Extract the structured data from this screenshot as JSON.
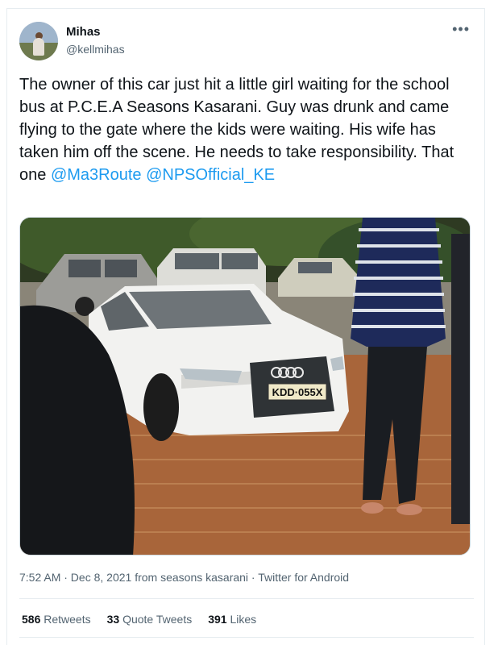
{
  "author": {
    "display_name": "Mihas",
    "handle": "@kellmihas"
  },
  "tweet": {
    "text_before": "The owner of this car just hit a little girl waiting for the school bus at P.C.E.A Seasons Kasarani. Guy was drunk and came flying to the gate where the kids were waiting. His wife has taken him off the scene. He needs to take responsibility. That one ",
    "mention_1": "@Ma3Route",
    "mention_2": "@NPSOfficial_KE"
  },
  "photo": {
    "plate_text": "KDD·055X"
  },
  "meta": {
    "timestamp": "7:52 AM · Dec 8, 2021 from seasons kasarani · Twitter for Android"
  },
  "stats": {
    "retweets_count": "586",
    "retweets_label": "Retweets",
    "quotes_count": "33",
    "quotes_label": "Quote Tweets",
    "likes_count": "391",
    "likes_label": "Likes"
  },
  "icons": {
    "more": "more-options-icon"
  }
}
